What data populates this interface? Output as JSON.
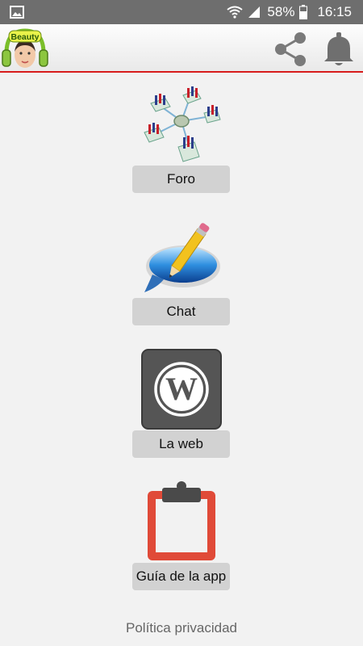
{
  "status_bar": {
    "battery_percent": "58%",
    "time": "16:15",
    "icons": [
      "image-icon",
      "wifi-icon",
      "signal-icon",
      "battery-icon"
    ]
  },
  "app_bar": {
    "logo_text": "Beauty",
    "actions": [
      "share-icon",
      "bell-icon"
    ],
    "accent_color": "#d81c1c"
  },
  "menu": {
    "items": [
      {
        "label": "Foro",
        "icon": "network-icon"
      },
      {
        "label": "Chat",
        "icon": "chat-pencil-icon"
      },
      {
        "label": "La web",
        "icon": "wordpress-icon"
      },
      {
        "label": "Guía de la app",
        "icon": "clipboard-icon"
      }
    ]
  },
  "footer": {
    "privacy_label": "Política privacidad"
  }
}
